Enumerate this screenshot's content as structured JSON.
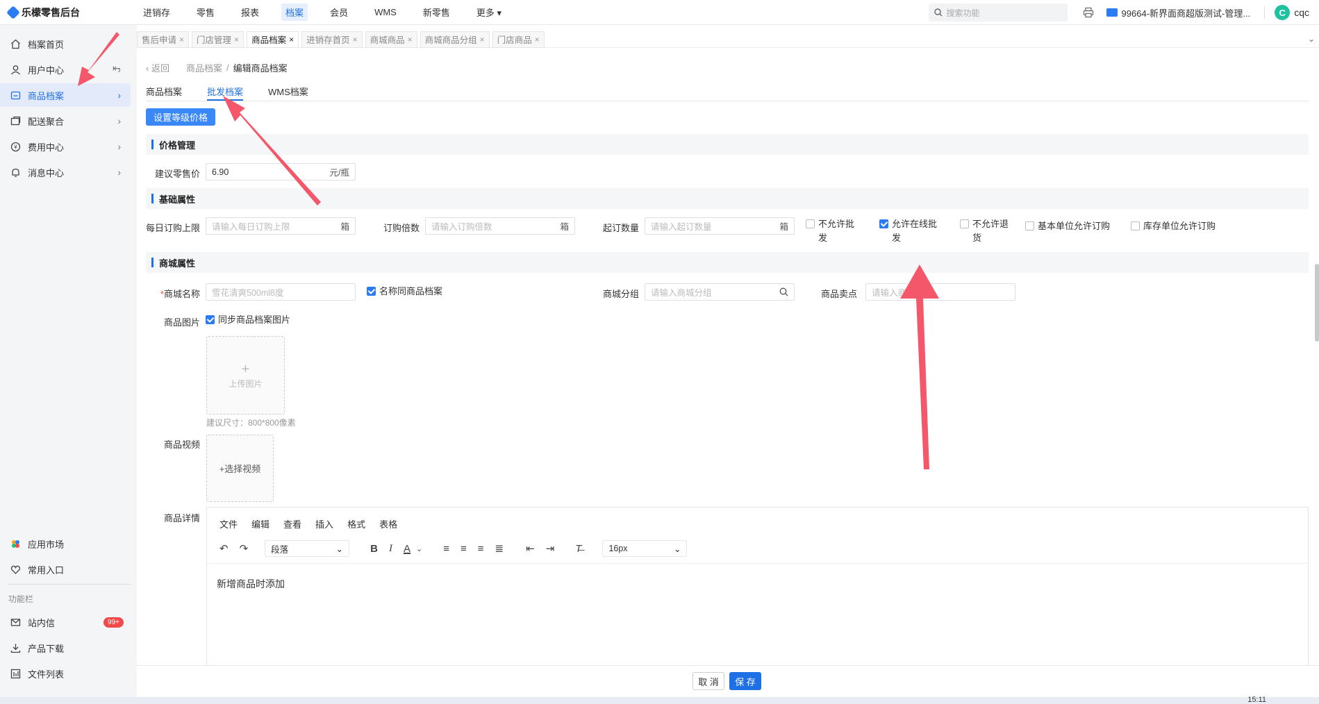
{
  "app": {
    "title": "乐檬零售后台"
  },
  "topnav": {
    "items": [
      "进销存",
      "零售",
      "报表",
      "档案",
      "会员",
      "WMS",
      "新零售",
      "更多"
    ],
    "active_index": 3,
    "search_placeholder": "搜索功能",
    "store": "99664-新界面商超版测试-管理...",
    "user_initial": "C",
    "user_name": "cqc"
  },
  "sidebar": {
    "items": [
      {
        "label": "档案首页",
        "icon": "home-icon"
      },
      {
        "label": "用户中心",
        "icon": "user-icon"
      },
      {
        "label": "商品档案",
        "icon": "product-icon",
        "active": true
      },
      {
        "label": "配送聚合",
        "icon": "delivery-icon"
      },
      {
        "label": "费用中心",
        "icon": "fee-icon"
      },
      {
        "label": "消息中心",
        "icon": "bell-icon"
      }
    ],
    "bottom_items": [
      {
        "label": "应用市场",
        "icon": "app-market-icon"
      },
      {
        "label": "常用入口",
        "icon": "heart-icon"
      }
    ],
    "tools_label": "功能栏",
    "tool_items": [
      {
        "label": "站内信",
        "icon": "mail-icon",
        "badge": "99+"
      },
      {
        "label": "产品下载",
        "icon": "download-icon"
      },
      {
        "label": "文件列表",
        "icon": "file-list-icon"
      }
    ]
  },
  "tabs": [
    {
      "label": "售后申请"
    },
    {
      "label": "门店管理"
    },
    {
      "label": "商品档案",
      "active": true
    },
    {
      "label": "进销存首页"
    },
    {
      "label": "商城商品"
    },
    {
      "label": "商城商品分组"
    },
    {
      "label": "门店商品"
    }
  ],
  "breadcrumb": {
    "back": "返回",
    "parent": "商品档案",
    "sep": "/",
    "current": "编辑商品档案"
  },
  "inner_tabs": [
    "商品档案",
    "批发档案",
    "WMS档案"
  ],
  "set_price_button": "设置等级价格",
  "price_section": {
    "title": "价格管理",
    "retail_label": "建议零售价",
    "retail_value": "6.90",
    "retail_unit": "元/瓶"
  },
  "basic_section": {
    "title": "基础属性",
    "daily_limit_label": "每日订购上限",
    "daily_limit_placeholder": "请输入每日订购上限",
    "daily_limit_unit": "箱",
    "multiple_label": "订购倍数",
    "multiple_placeholder": "请输入订购倍数",
    "multiple_unit": "箱",
    "min_qty_label": "起订数量",
    "min_qty_placeholder": "请输入起订数量",
    "min_qty_unit": "箱",
    "checkboxes": [
      {
        "label": "不允许批发",
        "checked": false
      },
      {
        "label": "允许在线批发",
        "checked": true
      },
      {
        "label": "不允许退货",
        "checked": false
      },
      {
        "label": "基本单位允许订购",
        "checked": false
      },
      {
        "label": "库存单位允许订购",
        "checked": false
      }
    ]
  },
  "mall_section": {
    "title": "商城属性",
    "name_label": "商城名称",
    "name_required": "*",
    "name_placeholder": "雪花清爽500ml8度",
    "same_name_label": "名称同商品档案",
    "same_name_checked": true,
    "group_label": "商城分组",
    "group_placeholder": "请输入商城分组",
    "selling_point_label": "商品卖点",
    "selling_point_placeholder": "请输入商",
    "image_label": "商品图片",
    "sync_image_label": "同步商品档案图片",
    "sync_image_checked": true,
    "upload_plus": "+",
    "upload_text": "上传图片",
    "size_hint": "建议尺寸：800*800像素",
    "video_label": "商品视频",
    "video_text": "+选择视频",
    "detail_label": "商品详情"
  },
  "editor": {
    "menu": [
      "文件",
      "编辑",
      "查看",
      "插入",
      "格式",
      "表格"
    ],
    "block_format": "段落",
    "font_size": "16px",
    "content": "新增商品时添加"
  },
  "footer": {
    "cancel": "取 消",
    "save": "保 存"
  },
  "clock": "15:11",
  "colors": {
    "accent": "#1f6fe5",
    "annotation": "#f4566a",
    "badge": "#f04a4a"
  }
}
